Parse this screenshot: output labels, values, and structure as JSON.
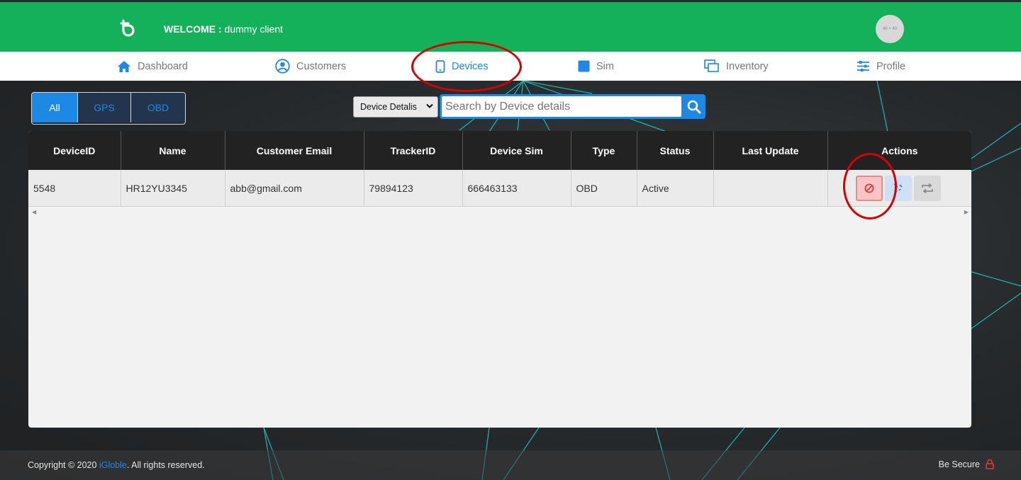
{
  "header": {
    "welcome_label": "WELCOME :",
    "welcome_name": "dummy client",
    "avatar_text": "40 × 40"
  },
  "nav": {
    "items": [
      {
        "label": "Dashboard",
        "icon": "home-icon"
      },
      {
        "label": "Customers",
        "icon": "user-circle-icon"
      },
      {
        "label": "Devices",
        "icon": "tablet-icon",
        "active": true
      },
      {
        "label": "Sim",
        "icon": "sim-square-icon"
      },
      {
        "label": "Inventory",
        "icon": "copy-windows-icon"
      },
      {
        "label": "Profile",
        "icon": "sliders-icon"
      }
    ]
  },
  "filters": {
    "items": [
      "All",
      "GPS",
      "OBD"
    ],
    "selected": "All"
  },
  "search": {
    "select_value": "Device Detalis",
    "placeholder": "Search by Device details"
  },
  "table": {
    "columns": [
      "DeviceID",
      "Name",
      "Customer Email",
      "TrackerID",
      "Device Sim",
      "Type",
      "Status",
      "Last Update",
      "Actions"
    ],
    "rows": [
      {
        "device_id": "5548",
        "name": "HR12YU3345",
        "email": "abb@gmail.com",
        "tracker_id": "79894123",
        "device_sim": "666463133",
        "type": "OBD",
        "status": "Active",
        "last_update": "",
        "actions": [
          "block-icon",
          "unlink-icon",
          "swap-icon"
        ]
      }
    ]
  },
  "footer": {
    "copyright_prefix": "Copyright © 2020 ",
    "brand": "iGloble",
    "copyright_suffix": ". All rights reserved.",
    "secure": "Be Secure"
  },
  "colors": {
    "header_green": "#14b15a",
    "accent_blue": "#1e88e5",
    "annotation_red": "#d60000"
  }
}
